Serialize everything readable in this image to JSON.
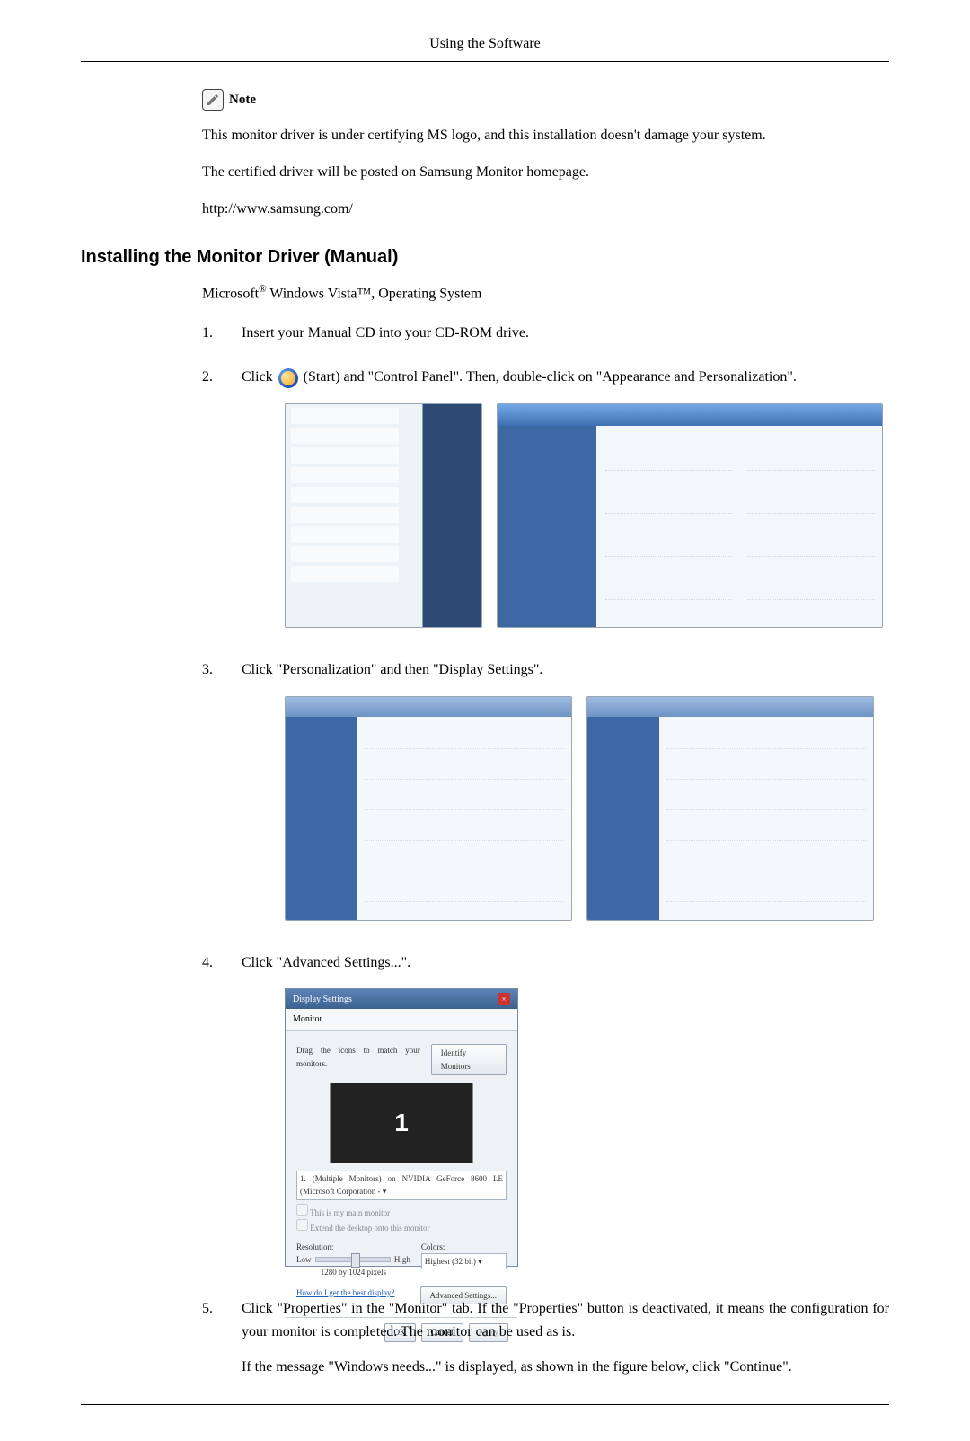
{
  "header": {
    "title": "Using the Software"
  },
  "note": {
    "label": "Note",
    "p1": "This monitor driver is under certifying MS logo, and this installation doesn't damage your system.",
    "p2": "The certified driver will be posted on Samsung Monitor homepage.",
    "p3": "http://www.samsung.com/"
  },
  "section": {
    "heading": "Installing the Monitor Driver (Manual)",
    "subtitle_prefix": "Microsoft",
    "subtitle_rest": " Windows Vista™, Operating System"
  },
  "steps": {
    "s1": {
      "num": "1.",
      "text": "Insert your Manual CD into your CD-ROM drive."
    },
    "s2": {
      "num": "2.",
      "text_a": "Click ",
      "text_b": "(Start) and \"Control Panel\". Then, double-click on \"Appearance and Personalization\"."
    },
    "s3": {
      "num": "3.",
      "text": "Click \"Personalization\" and then \"Display Settings\"."
    },
    "s4": {
      "num": "4.",
      "text": "Click \"Advanced Settings...\"."
    },
    "s5": {
      "num": "5.",
      "text": "Click \"Properties\" in the \"Monitor\" tab. If the \"Properties\" button is deactivated, it means the configuration for your monitor is completed. The monitor can be used as is.",
      "text2": "If the message \"Windows needs...\" is displayed, as shown in the figure below, click \"Continue\"."
    }
  },
  "display_settings": {
    "title": "Display Settings",
    "tab": "Monitor",
    "drag_text": "Drag the icons to match your monitors.",
    "identify_btn": "Identify Monitors",
    "screen_num": "1",
    "device_sel": "1. (Multiple Monitors) on NVIDIA GeForce 8600 LE (Microsoft Corporation - ▾",
    "chk_main": "This is my main monitor",
    "chk_extend": "Extend the desktop onto this monitor",
    "res_label": "Resolution:",
    "res_low": "Low",
    "res_high": "High",
    "res_value": "1280 by 1024 pixels",
    "color_label": "Colors:",
    "color_value": "Highest (32 bit)    ▾",
    "help_link": "How do I get the best display?",
    "adv_btn": "Advanced Settings...",
    "ok_btn": "OK",
    "cancel_btn": "Cancel",
    "apply_btn": "Apply"
  }
}
